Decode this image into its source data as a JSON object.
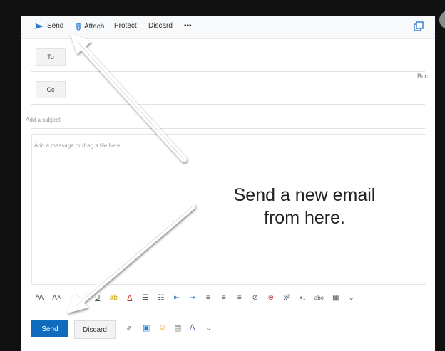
{
  "toolbar": {
    "send_label": "Send",
    "attach_label": "Attach",
    "protect_label": "Protect",
    "discard_label": "Discard",
    "more_label": "•••"
  },
  "compose": {
    "to_label": "To",
    "cc_label": "Cc",
    "bcc_label": "Bcc",
    "subject_placeholder": "Add a subject",
    "body_placeholder": "Add a message or drag a file here"
  },
  "format_toolbar": {
    "items": [
      "AA",
      "A",
      "U",
      "ab",
      "A",
      "list",
      "list",
      "indent",
      "outdent",
      "align",
      "align",
      "align",
      "link",
      "unlink",
      "x²",
      "x₂",
      "abc",
      "table",
      "more"
    ]
  },
  "footer": {
    "send_label": "Send",
    "discard_label": "Discard"
  },
  "annotation": {
    "line1": "Send a new email",
    "line2": "from here."
  },
  "colors": {
    "accent": "#0f6cbd",
    "frame": "#111111"
  }
}
